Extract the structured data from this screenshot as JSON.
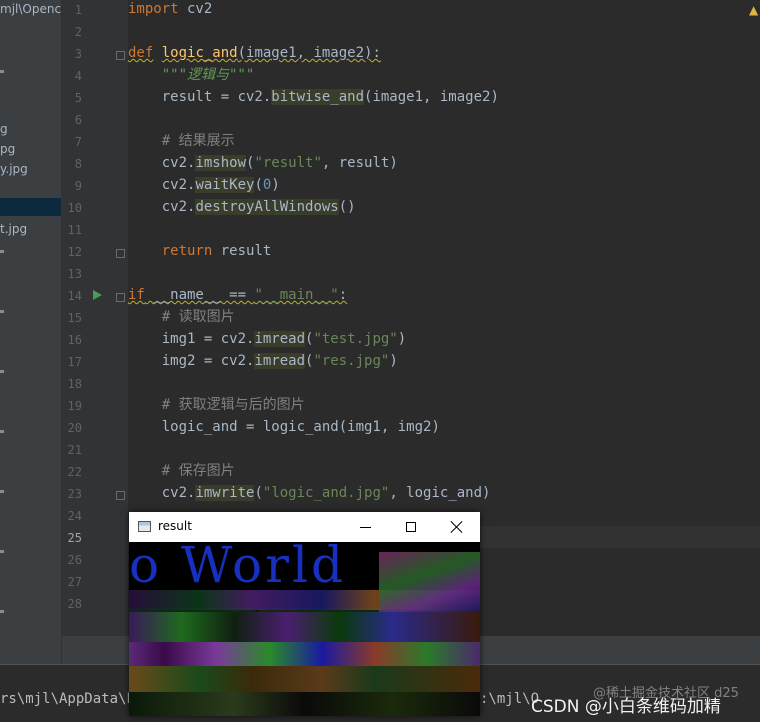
{
  "project": {
    "path": "mjl\\Openc",
    "files": [
      "g",
      "pg",
      "y.jpg",
      "",
      "t.jpg"
    ]
  },
  "editor": {
    "line_numbers": [
      "1",
      "2",
      "3",
      "4",
      "5",
      "6",
      "7",
      "8",
      "9",
      "10",
      "11",
      "12",
      "13",
      "14",
      "15",
      "16",
      "17",
      "18",
      "19",
      "20",
      "21",
      "22",
      "23",
      "24",
      "25",
      "26",
      "27",
      "28"
    ],
    "current_line": "25",
    "lines": {
      "l1_kw": "import",
      "l1_rest": " cv2",
      "l3_kw": "def",
      "l3_fn": "logic_and",
      "l3_rest": "(image1, image2):",
      "l4_doc": "\"\"\"逻辑与\"\"\"",
      "l5_a": "result = cv2.",
      "l5_fn": "bitwise_and",
      "l5_b": "(image1, image2)",
      "l7_cmt": "# 结果展示",
      "l8_a": "cv2.",
      "l8_fn": "imshow",
      "l8_b": "(",
      "l8_str": "\"result\"",
      "l8_c": ", result)",
      "l9_a": "cv2.",
      "l9_fn": "waitKey",
      "l9_b": "(",
      "l9_num": "0",
      "l9_c": ")",
      "l10_a": "cv2.",
      "l10_fn": "destroyAllWindows",
      "l10_b": "()",
      "l12_kw": "return",
      "l12_rest": " result",
      "l14_kw": "if",
      "l14_a": " __name__ == ",
      "l14_str": "\"__main__\"",
      "l14_b": ":",
      "l15_cmt": "# 读取图片",
      "l16_a": "img1 = cv2.",
      "l16_fn": "imread",
      "l16_b": "(",
      "l16_str": "\"test.jpg\"",
      "l16_c": ")",
      "l17_a": "img2 = cv2.",
      "l17_fn": "imread",
      "l17_b": "(",
      "l17_str": "\"res.jpg\"",
      "l17_c": ")",
      "l19_cmt": "# 获取逻辑与后的图片",
      "l20": "logic_and = logic_and(img1, img2)",
      "l22_cmt": "# 保存图片",
      "l23_a": "cv2.",
      "l23_fn": "imwrite",
      "l23_b": "(",
      "l23_str": "\"logic_and.jpg\"",
      "l23_c": ", logic_and)"
    }
  },
  "result_window": {
    "title": "result",
    "image_text": "o World"
  },
  "terminal": {
    "left_text": "rs\\mjl\\AppData\\Lo",
    "right_text": ":\\mjl\\O"
  },
  "watermark": {
    "main": "CSDN @小白条维码加精",
    "faint": "@稀土掘金技术社区 d25"
  },
  "colors": {
    "editor_bg": "#2b2b2b",
    "keyword": "#cc7832",
    "function": "#ffc66d",
    "string": "#6a8759",
    "comment": "#808080"
  }
}
